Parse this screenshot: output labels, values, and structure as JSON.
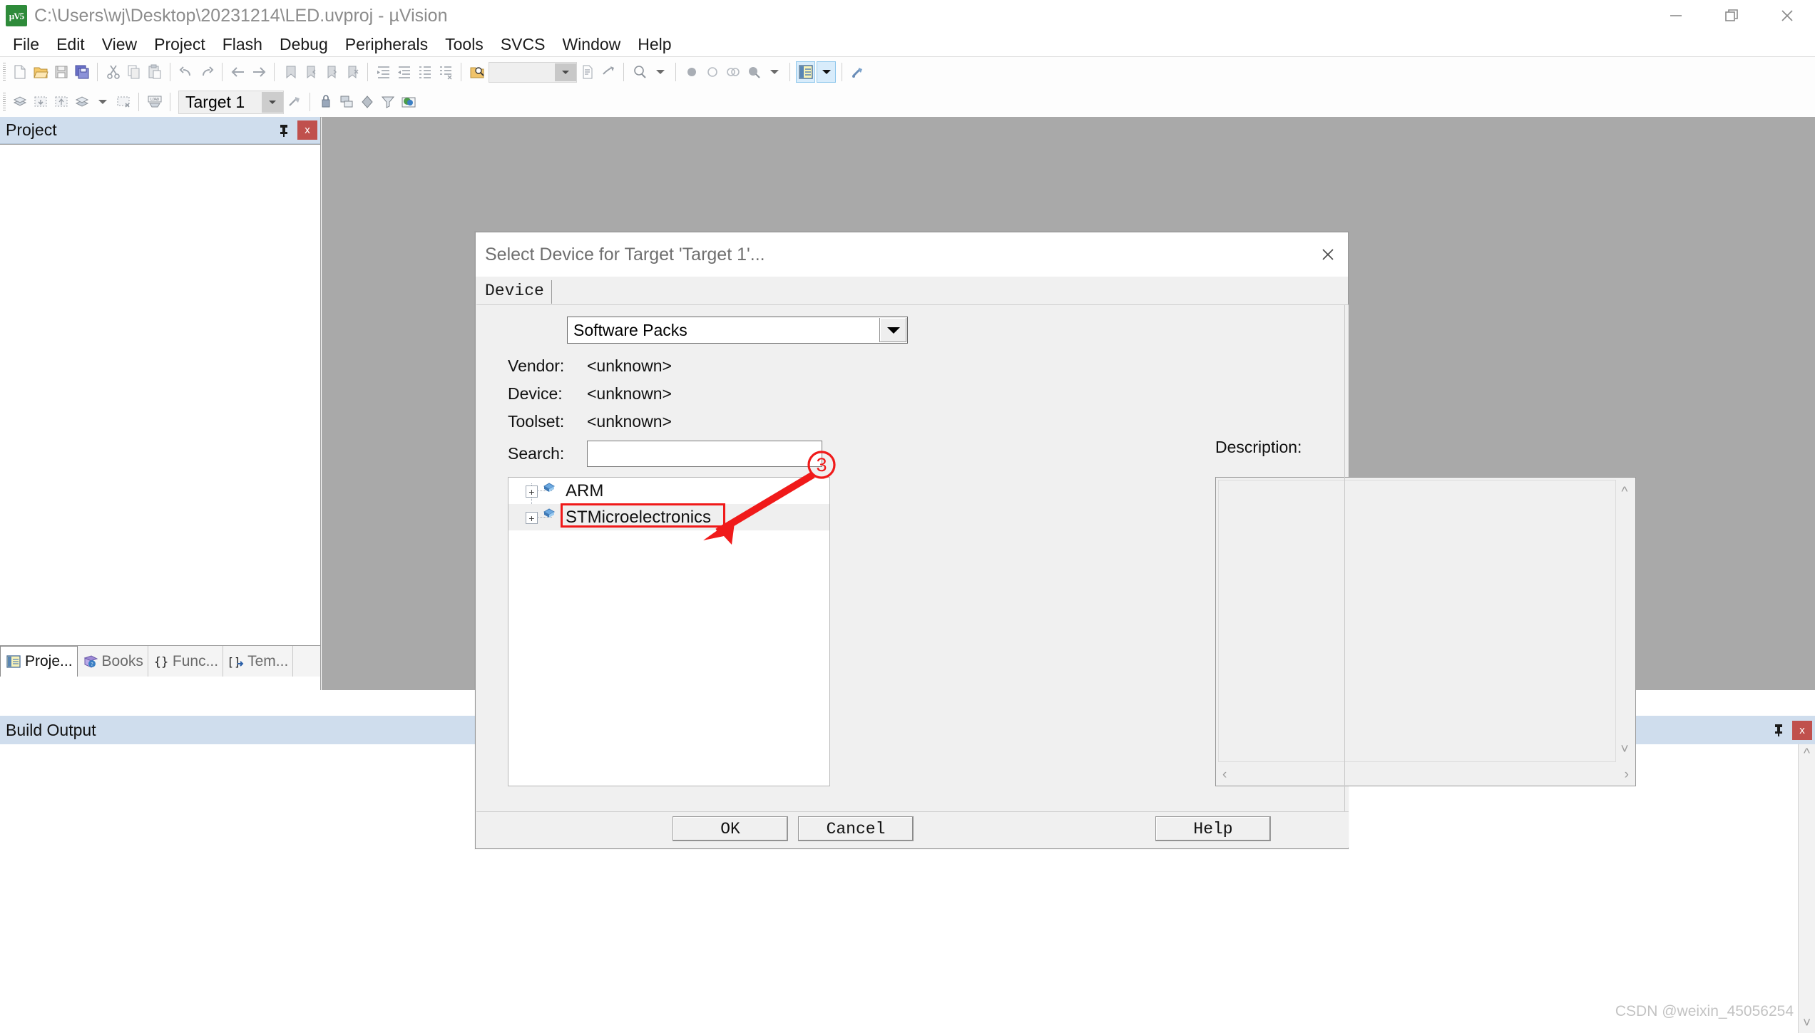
{
  "window": {
    "title": "C:\\Users\\wj\\Desktop\\20231214\\LED.uvproj - µVision",
    "app_icon_text": "µV5",
    "controls": {
      "minimize": "minimize-icon",
      "restore": "restore-icon",
      "close": "close-icon"
    }
  },
  "menubar": {
    "items": [
      {
        "label": "File"
      },
      {
        "label": "Edit"
      },
      {
        "label": "View"
      },
      {
        "label": "Project"
      },
      {
        "label": "Flash"
      },
      {
        "label": "Debug"
      },
      {
        "label": "Peripherals"
      },
      {
        "label": "Tools"
      },
      {
        "label": "SVCS"
      },
      {
        "label": "Window"
      },
      {
        "label": "Help"
      }
    ]
  },
  "toolbar_main": {
    "icons": [
      "new-file-icon",
      "open-file-icon",
      "save-icon",
      "save-all-icon",
      "cut-icon",
      "copy-icon",
      "paste-icon",
      "undo-icon",
      "redo-icon",
      "navigate-back-icon",
      "navigate-forward-icon",
      "bookmark-toggle-icon",
      "bookmark-prev-icon",
      "bookmark-next-icon",
      "bookmark-clear-icon",
      "indent-icon",
      "outdent-icon",
      "comment-icon",
      "uncomment-icon",
      "find-in-files-icon"
    ],
    "combo_value": "",
    "icons_after": [
      "insert-file-icon",
      "configure-icon",
      "find-icon",
      "find-dropdown-icon",
      "breakpoint-icon",
      "breakpoint-disable-icon",
      "breakpoint-all-icon",
      "breakpoint-kill-icon",
      "breakpoint-dropdown-icon",
      "project-window-icon",
      "project-window-dropdown-icon",
      "configure-target-icon"
    ]
  },
  "toolbar_build": {
    "icons": [
      "translate-icon",
      "build-icon",
      "rebuild-icon",
      "batch-build-icon",
      "batch-build-dropdown-icon",
      "stop-build-icon",
      "download-icon"
    ],
    "target_select": "Target 1",
    "icons_after": [
      "target-options-icon",
      "manage-components-icon",
      "pack-installer-icon",
      "manage-runtime-icon",
      "svcs-icon"
    ]
  },
  "project_panel": {
    "title": "Project",
    "pin_icon": "pin-icon",
    "close_icon": "close-icon",
    "tabs": [
      {
        "label": "Proje...",
        "icon": "project-icon",
        "selected": true
      },
      {
        "label": "Books",
        "icon": "books-icon",
        "selected": false
      },
      {
        "label": "Func...",
        "icon": "functions-icon",
        "selected": false
      },
      {
        "label": "Tem...",
        "icon": "templates-icon",
        "selected": false
      }
    ]
  },
  "build_output": {
    "title": "Build Output",
    "pin_icon": "pin-icon",
    "close_icon": "close-icon"
  },
  "dialog": {
    "title": "Select Device for Target 'Target 1'...",
    "close_icon": "close-icon",
    "tab": "Device",
    "packs_combo": {
      "value": "Software Packs",
      "dropdown_icon": "chevron-down-icon"
    },
    "fields": [
      {
        "label": "Vendor:",
        "value": "<unknown>"
      },
      {
        "label": "Device:",
        "value": "<unknown>"
      },
      {
        "label": "Toolset:",
        "value": "<unknown>"
      }
    ],
    "search": {
      "label": "Search:",
      "value": "",
      "placeholder": ""
    },
    "description_label": "Description:",
    "description_value": "",
    "tree": [
      {
        "label": "ARM",
        "expander": "+",
        "icon": "device-family-icon",
        "selected": false,
        "highlighted": false
      },
      {
        "label": "STMicroelectronics",
        "expander": "+",
        "icon": "device-family-icon",
        "selected": true,
        "highlighted": true
      }
    ],
    "buttons": {
      "ok": "OK",
      "cancel": "Cancel",
      "help": "Help"
    },
    "scrollbars": {
      "desc_up": "chevron-up-icon",
      "desc_down": "chevron-down-icon",
      "desc_left": "chevron-left-icon",
      "desc_right": "chevron-right-icon"
    }
  },
  "annotation": {
    "step_number": "3",
    "color": "#f01a1a",
    "arrow": "red-arrow-pointing-to-stmicroelectronics",
    "highlight_box": "red-rectangle-around-stmicroelectronics"
  },
  "watermark": {
    "text": "CSDN @weixin_45056254"
  },
  "colors": {
    "editor_background": "#a9a9a9",
    "dock_header": "#cfdded",
    "dialog_background": "#f0f0f0",
    "annotation_red": "#f01a1a",
    "close_button_red": "#c0504d",
    "app_icon_green": "#2e8b3a"
  }
}
